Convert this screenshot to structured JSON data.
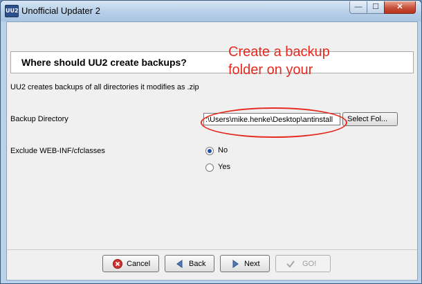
{
  "window": {
    "title": "Unofficial Updater 2",
    "app_icon_text": "UU2"
  },
  "controls": {
    "minimize": "—",
    "maximize": "☐",
    "close": "✕"
  },
  "header": {
    "title": "Where should UU2 create backups?"
  },
  "description": "UU2 creates backups of all directories it modifies as .zip",
  "backup": {
    "label": "Backup Directory",
    "value": ":\\Users\\mike.henke\\Desktop\\antinstall",
    "button": "Select Fol..."
  },
  "exclude": {
    "label": "Exclude WEB-INF/cfclasses",
    "options": [
      {
        "label": "No",
        "selected": true
      },
      {
        "label": "Yes",
        "selected": false
      }
    ]
  },
  "annotation": {
    "line1": "Create a backup",
    "line2": "folder on your",
    "color": "#e52a1f"
  },
  "buttons": {
    "cancel": "Cancel",
    "back": "Back",
    "next": "Next",
    "go": "GO!"
  }
}
